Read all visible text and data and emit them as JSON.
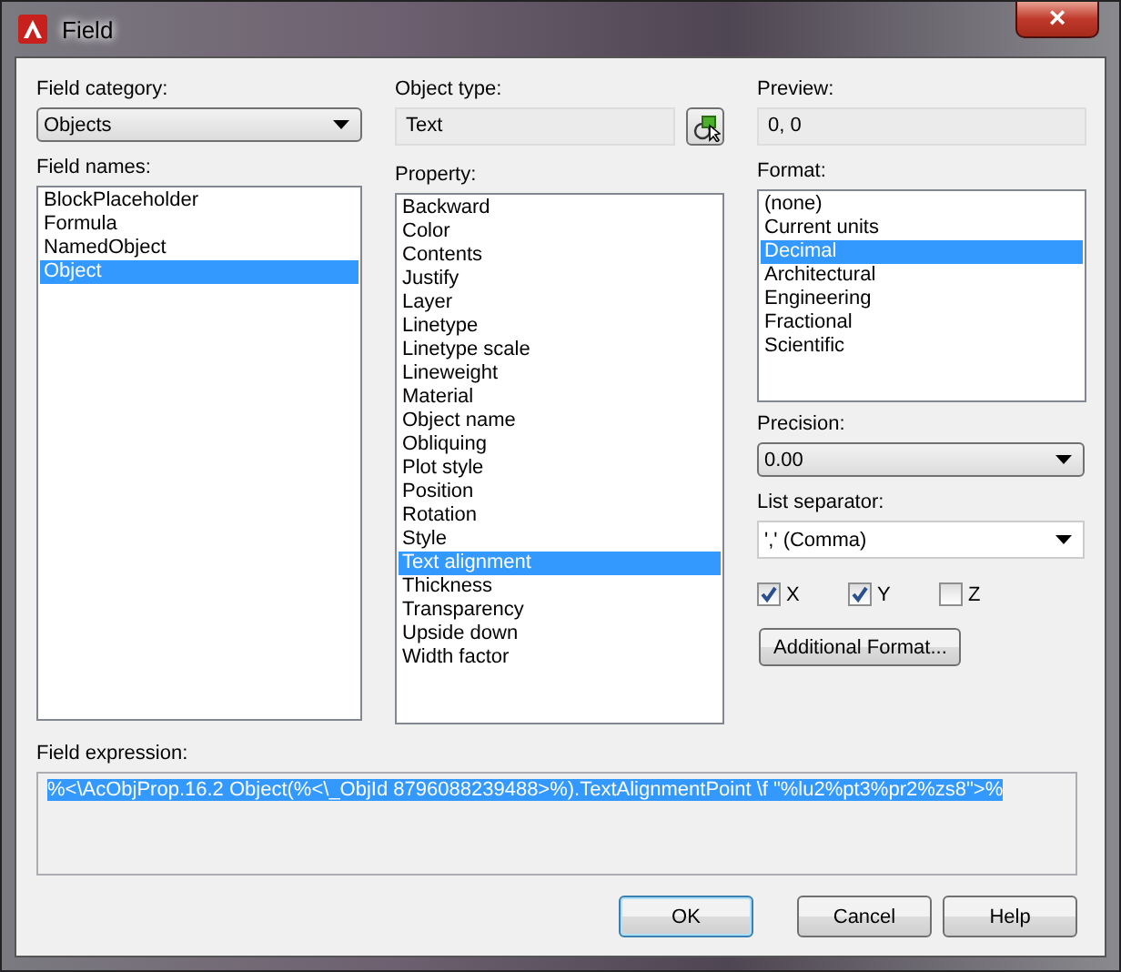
{
  "window": {
    "title": "Field",
    "close": "×"
  },
  "field_category": {
    "label": "Field category:",
    "value": "Objects"
  },
  "field_names": {
    "label": "Field names:",
    "items": [
      {
        "label": "BlockPlaceholder",
        "selected": false
      },
      {
        "label": "Formula",
        "selected": false
      },
      {
        "label": "NamedObject",
        "selected": false
      },
      {
        "label": "Object",
        "selected": true
      }
    ]
  },
  "object_type": {
    "label": "Object type:",
    "value": "Text"
  },
  "property": {
    "label": "Property:",
    "items": [
      {
        "label": "Backward",
        "selected": false
      },
      {
        "label": "Color",
        "selected": false
      },
      {
        "label": "Contents",
        "selected": false
      },
      {
        "label": "Justify",
        "selected": false
      },
      {
        "label": "Layer",
        "selected": false
      },
      {
        "label": "Linetype",
        "selected": false
      },
      {
        "label": "Linetype scale",
        "selected": false
      },
      {
        "label": "Lineweight",
        "selected": false
      },
      {
        "label": "Material",
        "selected": false
      },
      {
        "label": "Object name",
        "selected": false
      },
      {
        "label": "Obliquing",
        "selected": false
      },
      {
        "label": "Plot style",
        "selected": false
      },
      {
        "label": "Position",
        "selected": false
      },
      {
        "label": "Rotation",
        "selected": false
      },
      {
        "label": "Style",
        "selected": false
      },
      {
        "label": "Text alignment",
        "selected": true
      },
      {
        "label": "Thickness",
        "selected": false
      },
      {
        "label": "Transparency",
        "selected": false
      },
      {
        "label": "Upside down",
        "selected": false
      },
      {
        "label": "Width factor",
        "selected": false
      }
    ]
  },
  "preview": {
    "label": "Preview:",
    "value": "0, 0"
  },
  "format": {
    "label": "Format:",
    "items": [
      {
        "label": "(none)",
        "selected": false
      },
      {
        "label": "Current units",
        "selected": false
      },
      {
        "label": "Decimal",
        "selected": true
      },
      {
        "label": "Architectural",
        "selected": false
      },
      {
        "label": "Engineering",
        "selected": false
      },
      {
        "label": "Fractional",
        "selected": false
      },
      {
        "label": "Scientific",
        "selected": false
      }
    ]
  },
  "precision": {
    "label": "Precision:",
    "value": "0.00"
  },
  "list_separator": {
    "label": "List separator:",
    "value": "',' (Comma)"
  },
  "axes": [
    {
      "label": "X",
      "checked": true
    },
    {
      "label": "Y",
      "checked": true
    },
    {
      "label": "Z",
      "checked": false
    }
  ],
  "additional_format_button": "Additional Format...",
  "field_expression": {
    "label": "Field expression:",
    "value": "%<\\AcObjProp.16.2 Object(%<\\_ObjId 8796088239488>%).TextAlignmentPoint \\f \"%lu2%pt3%pr2%zs8\">%"
  },
  "buttons": [
    {
      "label": "OK",
      "default": true
    },
    {
      "label": "Cancel",
      "default": false
    },
    {
      "label": "Help",
      "default": false
    }
  ]
}
